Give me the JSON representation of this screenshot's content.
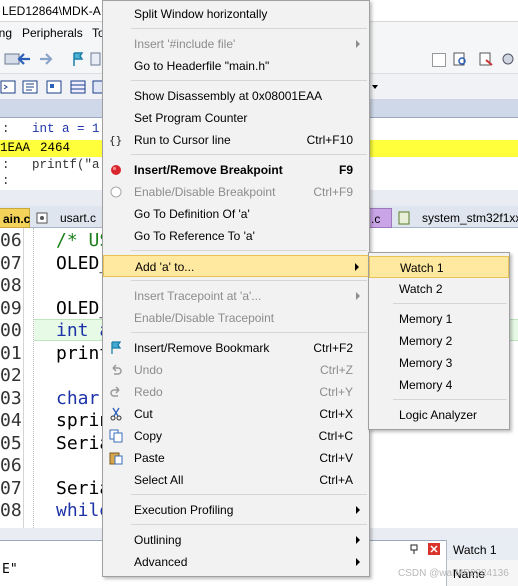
{
  "app": {
    "title_fragment": "LED12864\\MDK-A",
    "menu_fragments": [
      "ing",
      "Peripherals",
      "To"
    ]
  },
  "disassembly": {
    "lines": [
      {
        "prefix": ":",
        "text": "int a = 1"
      },
      {
        "prefix": "1EAA",
        "text": "2464",
        "highlighted": true
      },
      {
        "prefix": ":",
        "text": "printf(\"a"
      },
      {
        "prefix": ":",
        "text": ""
      }
    ]
  },
  "tabs": [
    {
      "label": "ain.c",
      "active": true
    },
    {
      "label": "usart.c",
      "active": false
    },
    {
      "label": ".c",
      "active": false
    },
    {
      "label": "system_stm32f1xx.c",
      "active": false
    }
  ],
  "editor": {
    "line_numbers": [
      "06",
      "07",
      "08",
      "09",
      "00",
      "01",
      "02",
      "03",
      "04",
      "05",
      "06",
      "07",
      "08"
    ],
    "lines": [
      {
        "text": "/* US",
        "style": "comment"
      },
      {
        "text": "OLED_",
        "style": "normal"
      },
      {
        "text": "",
        "style": "normal"
      },
      {
        "text": "OLED_",
        "style": "normal"
      },
      {
        "text": "int a",
        "style": "kw"
      },
      {
        "text": "print",
        "style": "normal"
      },
      {
        "text": "",
        "style": "normal"
      },
      {
        "text": "char",
        "style": "kw"
      },
      {
        "text": "sprin",
        "style": "normal"
      },
      {
        "text": "Seria",
        "style": "normal"
      },
      {
        "text": "",
        "style": "normal"
      },
      {
        "text": "Seria",
        "style": "normal"
      },
      {
        "text": "while",
        "style": "kw"
      }
    ]
  },
  "bottom": {
    "watch_tab": "Watch 1",
    "name_column": "Name",
    "string_fragment": "E\"",
    "watermark": "CSDN @waIMP2224136"
  },
  "context_menu": {
    "items": [
      {
        "label": "Split Window horizontally",
        "shortcut": "",
        "disabled": false,
        "submenu": false,
        "icon": ""
      },
      {
        "sep": true
      },
      {
        "label": "Insert '#include file'",
        "shortcut": "",
        "disabled": true,
        "submenu": true,
        "icon": ""
      },
      {
        "label": "Go to Headerfile \"main.h\"",
        "shortcut": "",
        "disabled": false,
        "submenu": false,
        "icon": ""
      },
      {
        "sep": true
      },
      {
        "label": "Show Disassembly at 0x08001EAA",
        "shortcut": "",
        "disabled": false,
        "submenu": false,
        "icon": ""
      },
      {
        "label": "Set Program Counter",
        "shortcut": "",
        "disabled": false,
        "submenu": false,
        "icon": ""
      },
      {
        "label": "Run to Cursor line",
        "shortcut": "Ctrl+F10",
        "disabled": false,
        "submenu": false,
        "icon": "run-to-cursor-icon"
      },
      {
        "sep": true
      },
      {
        "label": "Insert/Remove Breakpoint",
        "shortcut": "F9",
        "disabled": false,
        "submenu": false,
        "bold": true,
        "icon": "breakpoint-icon"
      },
      {
        "label": "Enable/Disable Breakpoint",
        "shortcut": "Ctrl+F9",
        "disabled": true,
        "submenu": false,
        "icon": "breakpoint-disabled-icon"
      },
      {
        "label": "Go To Definition Of 'a'",
        "shortcut": "",
        "disabled": false,
        "submenu": false,
        "icon": ""
      },
      {
        "label": "Go To Reference To 'a'",
        "shortcut": "",
        "disabled": false,
        "submenu": false,
        "icon": ""
      },
      {
        "sep": true
      },
      {
        "label": "Add 'a' to...",
        "shortcut": "",
        "disabled": false,
        "submenu": true,
        "selected": true,
        "icon": ""
      },
      {
        "sep": true
      },
      {
        "label": "Insert Tracepoint at 'a'...",
        "shortcut": "",
        "disabled": true,
        "submenu": true,
        "icon": ""
      },
      {
        "label": "Enable/Disable Tracepoint",
        "shortcut": "",
        "disabled": true,
        "submenu": false,
        "icon": ""
      },
      {
        "sep": true
      },
      {
        "label": "Insert/Remove Bookmark",
        "shortcut": "Ctrl+F2",
        "disabled": false,
        "submenu": false,
        "icon": "bookmark-icon"
      },
      {
        "label": "Undo",
        "shortcut": "Ctrl+Z",
        "disabled": true,
        "submenu": false,
        "icon": "undo-icon"
      },
      {
        "label": "Redo",
        "shortcut": "Ctrl+Y",
        "disabled": true,
        "submenu": false,
        "icon": "redo-icon"
      },
      {
        "label": "Cut",
        "shortcut": "Ctrl+X",
        "disabled": false,
        "submenu": false,
        "icon": "cut-icon"
      },
      {
        "label": "Copy",
        "shortcut": "Ctrl+C",
        "disabled": false,
        "submenu": false,
        "icon": "copy-icon"
      },
      {
        "label": "Paste",
        "shortcut": "Ctrl+V",
        "disabled": false,
        "submenu": false,
        "icon": "paste-icon"
      },
      {
        "label": "Select All",
        "shortcut": "Ctrl+A",
        "disabled": false,
        "submenu": false,
        "icon": ""
      },
      {
        "sep": true
      },
      {
        "label": "Execution Profiling",
        "shortcut": "",
        "disabled": false,
        "submenu": true,
        "icon": ""
      },
      {
        "sep": true
      },
      {
        "label": "Outlining",
        "shortcut": "",
        "disabled": false,
        "submenu": true,
        "icon": ""
      },
      {
        "label": "Advanced",
        "shortcut": "",
        "disabled": false,
        "submenu": true,
        "icon": ""
      }
    ]
  },
  "submenu": {
    "items": [
      {
        "label": "Watch 1",
        "selected": true
      },
      {
        "label": "Watch 2"
      },
      {
        "sep": true
      },
      {
        "label": "Memory 1"
      },
      {
        "label": "Memory 2"
      },
      {
        "label": "Memory 3"
      },
      {
        "label": "Memory 4"
      },
      {
        "sep": true
      },
      {
        "label": "Logic Analyzer"
      }
    ]
  },
  "colors": {
    "menu_bg": "#f2f2f2",
    "highlight": "#ffe9a0",
    "disasm_highlight": "#ffff3c",
    "comment": "#1c7f1c",
    "keyword": "#1d33a8"
  }
}
